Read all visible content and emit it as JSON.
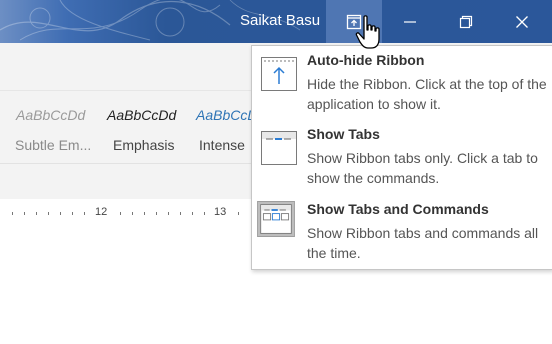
{
  "window": {
    "user_name": "Saikat Basu",
    "controls": [
      "ribbon-display-options",
      "minimize",
      "restore",
      "close"
    ]
  },
  "ribbon": {
    "styles": [
      {
        "sample": "AaBbCcDd",
        "label": "Subtle Em...",
        "color": "#9a9a9a"
      },
      {
        "sample": "AaBbCcDd",
        "label": "Emphasis",
        "color": "#222222"
      },
      {
        "sample": "AaBbCcDd",
        "label": "Intense",
        "color": "#2e74b5"
      }
    ]
  },
  "ruler": {
    "labels": [
      "12",
      "13"
    ]
  },
  "ribbon_display_menu": {
    "items": [
      {
        "title": "Auto-hide Ribbon",
        "description": "Hide the Ribbon. Click at the top of the application to show it.",
        "icon": "auto-hide-ribbon-icon"
      },
      {
        "title": "Show Tabs",
        "description": "Show Ribbon tabs only. Click a tab to show the commands.",
        "icon": "show-tabs-icon"
      },
      {
        "title": "Show Tabs and Commands",
        "description": "Show Ribbon tabs and commands all the time.",
        "icon": "show-tabs-and-commands-icon",
        "selected": true
      }
    ]
  },
  "colors": {
    "titlebar": "#2b579a",
    "accent": "#2b579a"
  }
}
